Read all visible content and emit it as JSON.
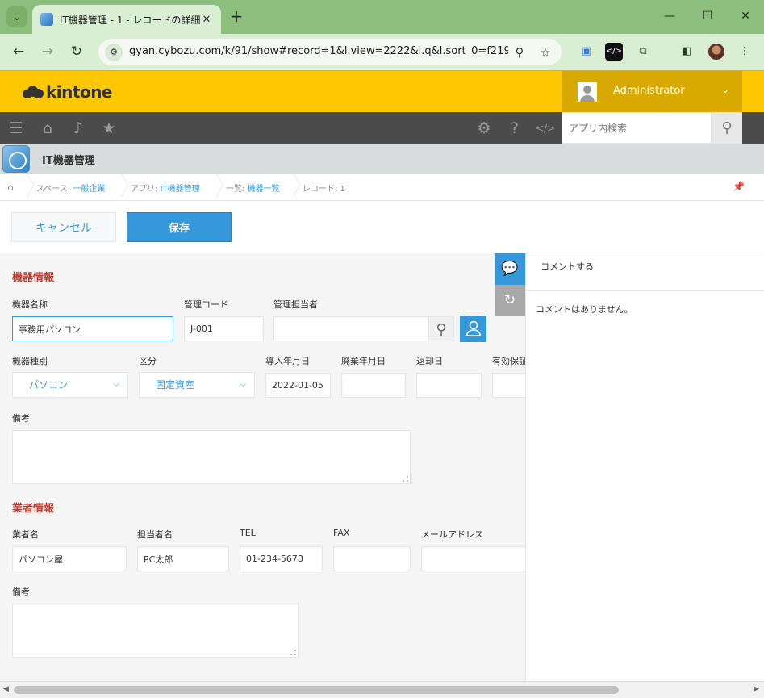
{
  "browser": {
    "tab_title": "IT機器管理 - 1 - レコードの詳細",
    "url": "gyan.cybozu.com/k/91/show#record=1&l.view=2222&l.q&l.sort_0=f2194..."
  },
  "header": {
    "logo": "kintone",
    "user": "Administrator",
    "search_placeholder": "アプリ内検索"
  },
  "app": {
    "title": "IT機器管理"
  },
  "breadcrumb": [
    {
      "prefix": "スペース: ",
      "link": "一般企業"
    },
    {
      "prefix": "アプリ: ",
      "link": "IT機器管理"
    },
    {
      "prefix": "一覧: ",
      "link": "機器一覧"
    },
    {
      "prefix": "レコード: 1",
      "link": ""
    }
  ],
  "actions": {
    "cancel": "キャンセル",
    "save": "保存"
  },
  "form": {
    "section1": "機器情報",
    "labels1": [
      "機器名称",
      "管理コード",
      "管理担当者"
    ],
    "device_name": "事務用パソコン",
    "mgmt_code": "J-001",
    "labels2": [
      "機器種別",
      "区分",
      "導入年月日",
      "廃棄年月日",
      "返却日",
      "有効保証"
    ],
    "device_type": "パソコン",
    "category": "固定資産",
    "install_date": "2022-01-05",
    "note_label": "備考",
    "section2": "業者情報",
    "labels3": [
      "業者名",
      "担当者名",
      "TEL",
      "FAX",
      "メールアドレス"
    ],
    "vendor_name": "パソコン屋",
    "contact_name": "PC太郎",
    "tel": "01-234-5678",
    "note_label2": "備考"
  },
  "side": {
    "comment_placeholder": "コメントする",
    "no_comments": "コメントはありません。"
  },
  "colors": {
    "accent": "#3498db",
    "header": "#fec800",
    "section": "#c0392b"
  }
}
